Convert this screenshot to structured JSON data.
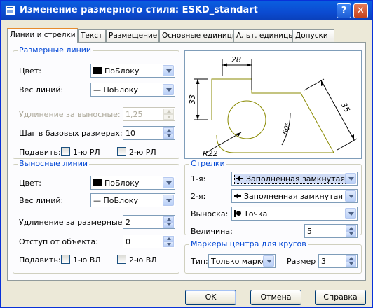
{
  "window": {
    "title": "Изменение размерного стиля: ESKD_standart",
    "help_glyph": "?",
    "close_glyph": "✕"
  },
  "tabs": [
    {
      "label": "Линии и стрелки",
      "active": true
    },
    {
      "label": "Текст"
    },
    {
      "label": "Размещение"
    },
    {
      "label": "Основные единицы"
    },
    {
      "label": "Альт. единицы"
    },
    {
      "label": "Допуски"
    }
  ],
  "dim_lines": {
    "title": "Размерные линии",
    "color_label": "Цвет:",
    "color_value": "ПоБлоку",
    "lineweight_label": "Вес линий:",
    "lineweight_value": "— ПоБлоку",
    "extend_label": "Удлинение за выносные:",
    "extend_value": "1,25",
    "baseline_label": "Шаг в базовых размерах:",
    "baseline_value": "10",
    "suppress_label": "Подавить:",
    "suppress_1": "1-ю РЛ",
    "suppress_2": "2-ю РЛ"
  },
  "ext_lines": {
    "title": "Выносные линии",
    "color_label": "Цвет:",
    "color_value": "ПоБлоку",
    "lineweight_label": "Вес линий:",
    "lineweight_value": "— ПоБлоку",
    "extend_label": "Удлинение за размерные:",
    "extend_value": "2",
    "offset_label": "Отступ от объекта:",
    "offset_value": "0",
    "suppress_label": "Подавить:",
    "suppress_1": "1-ю ВЛ",
    "suppress_2": "2-ю ВЛ"
  },
  "preview": {
    "dim_top": "28",
    "dim_left": "33",
    "dim_diag": "35",
    "dim_angle": "60°",
    "dim_radius": "R22"
  },
  "arrows": {
    "title": "Стрелки",
    "first_label": "1-я:",
    "first_value": "Заполненная замкнутая",
    "second_label": "2-я:",
    "second_value": "Заполненная замкнутая",
    "leader_label": "Выноска:",
    "leader_value": "Точка",
    "size_label": "Величина:",
    "size_value": "5"
  },
  "center_marks": {
    "title": "Маркеры центра для кругов",
    "type_label": "Тип:",
    "type_value": "Только маркер",
    "size_label": "Размер",
    "size_value": "3"
  },
  "buttons": {
    "ok": "OK",
    "cancel": "Отмена",
    "help": "Справка"
  },
  "colors": {
    "title_bar": "#0b4bd1",
    "group_title": "#0046d5",
    "tab_highlight": "#e68b2c",
    "dialog_bg": "#ece9d8"
  }
}
